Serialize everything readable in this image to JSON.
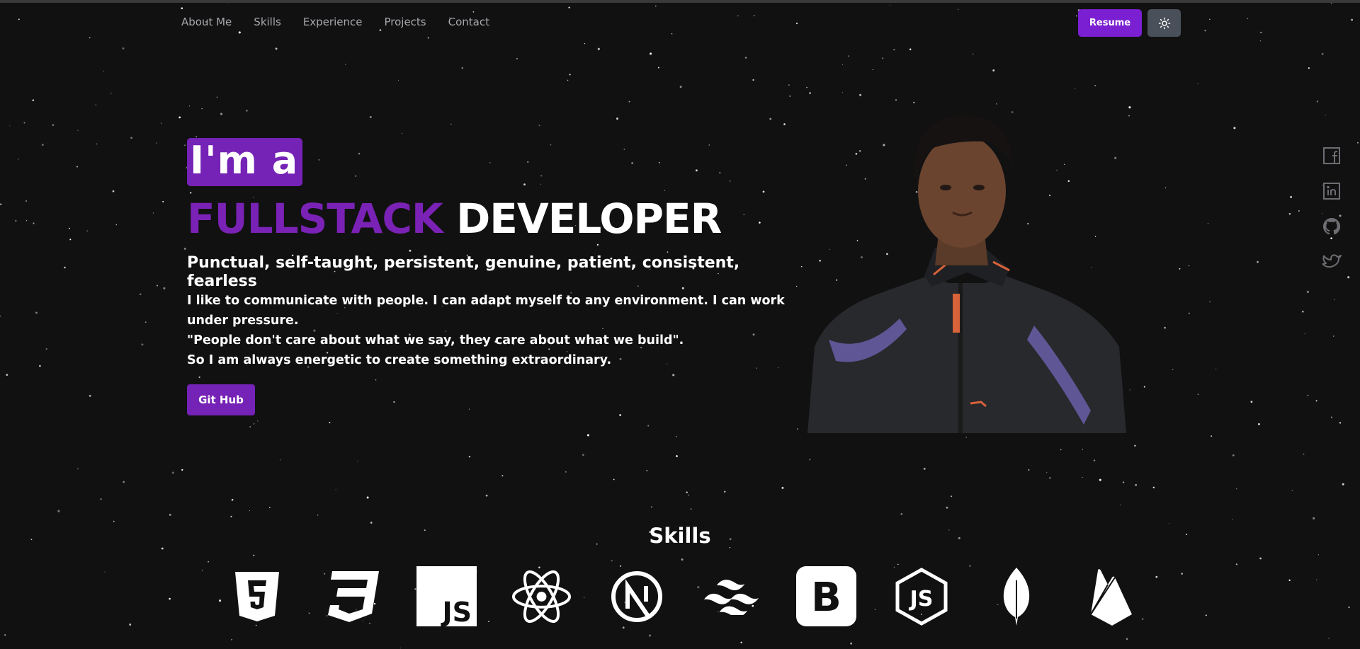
{
  "nav": {
    "items": [
      "About Me",
      "Skills",
      "Experience",
      "Projects",
      "Contact"
    ]
  },
  "header": {
    "resume_label": "Resume",
    "theme_icon": "sun-icon"
  },
  "hero": {
    "intro": "I'm a",
    "title_accent": "FULLSTACK",
    "title_rest": "DEVELOPER",
    "tagline": "Punctual, self-taught, persistent, genuine, patient, consistent, fearless",
    "description_lines": [
      "I like to communicate with people. I can adapt myself to any environment. I can work under pressure.",
      "\"People don't care about what we say, they care about what we build\".",
      "So I am always energetic to create something extraordinary."
    ],
    "github_label": "Git Hub"
  },
  "social": {
    "icons": [
      "facebook-icon",
      "linkedin-icon",
      "github-icon",
      "twitter-icon"
    ]
  },
  "skills": {
    "title": "Skills",
    "icons": [
      "html5-icon",
      "css3-icon",
      "javascript-icon",
      "react-icon",
      "nextjs-icon",
      "tailwind-icon",
      "bootstrap-icon",
      "nodejs-icon",
      "mongodb-icon",
      "firebase-icon"
    ]
  },
  "colors": {
    "accent": "#7522b6",
    "resume_button": "#7a1fd1",
    "background": "#111112"
  }
}
